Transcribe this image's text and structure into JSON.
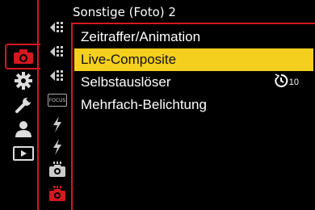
{
  "header": {
    "title": "Sonstige (Foto) 2"
  },
  "categories": [
    {
      "icon": "camera-icon",
      "active": true
    },
    {
      "icon": "gear-icon",
      "active": false
    },
    {
      "icon": "wrench-icon",
      "active": false
    },
    {
      "icon": "person-icon",
      "active": false
    },
    {
      "icon": "playback-icon",
      "active": false
    }
  ],
  "sub_tabs": [
    {
      "icon": "af-focus-icon"
    },
    {
      "icon": "af-focus-icon"
    },
    {
      "icon": "af-focus-icon"
    },
    {
      "icon": "focus-icon",
      "label": "FOCUS"
    },
    {
      "icon": "flash-icon"
    },
    {
      "icon": "flash-icon"
    },
    {
      "icon": "photo-other-icon"
    },
    {
      "icon": "photo-other-active-icon"
    }
  ],
  "menu": {
    "items": [
      {
        "label": "Zeitraffer/Animation",
        "value": ""
      },
      {
        "label": "Live-Composite",
        "value": "",
        "selected": true
      },
      {
        "label": "Selbstauslöser",
        "value": "10"
      },
      {
        "label": "Mehrfach-Belichtung",
        "value": ""
      }
    ]
  },
  "colors": {
    "accent": "#d4181f",
    "highlight": "#f4cf1e"
  }
}
